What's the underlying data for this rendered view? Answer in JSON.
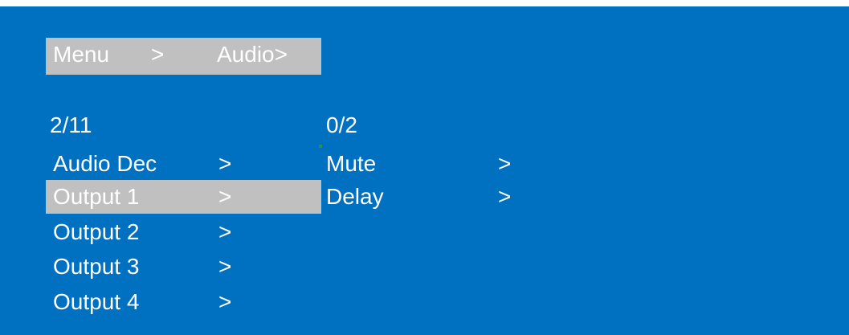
{
  "header": {
    "menu_label": "Menu",
    "separator": ">",
    "audio_label": "Audio>"
  },
  "left_list": {
    "counter": "2/11",
    "items": [
      {
        "label": "Audio Dec",
        "arrow": ">"
      },
      {
        "label": "Output 1",
        "arrow": ">",
        "selected": true
      },
      {
        "label": "Output 2",
        "arrow": ">"
      },
      {
        "label": "Output 3",
        "arrow": ">"
      },
      {
        "label": "Output 4",
        "arrow": ">"
      }
    ]
  },
  "right_list": {
    "counter": "0/2",
    "items": [
      {
        "label": "Mute",
        "arrow": ">"
      },
      {
        "label": "Delay",
        "arrow": ">"
      }
    ]
  },
  "colors": {
    "background": "#0070c0",
    "highlight": "#c0c0c0",
    "text": "#ffffff"
  }
}
